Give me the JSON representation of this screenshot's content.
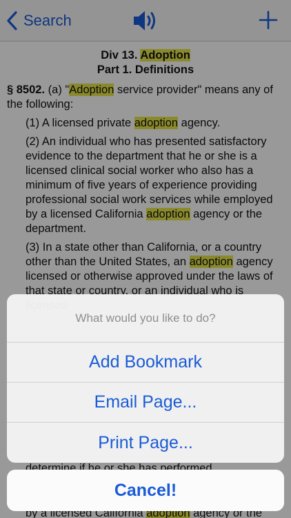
{
  "nav": {
    "back_label": "Search",
    "speaker_icon": "speaker-icon",
    "add_icon": "plus-icon"
  },
  "doc": {
    "div_prefix": "Div 13.",
    "div_highlight": "Adoption",
    "part_title": "Part 1. Definitions",
    "section": {
      "number": "§ 8502.",
      "lead": "(a) \"",
      "lead_hl": "Adoption",
      "lead_rest": " service provider\" means any of the following:"
    },
    "items": [
      {
        "pre": "(1) A licensed private ",
        "hl": "adoption",
        "post": " agency."
      },
      {
        "pre": "(2) An individual who has presented satisfactory evidence to the department that he or she is a licensed clinical social worker who also has a minimum of five years of experience providing professional social work services while employed by a licensed California ",
        "hl": "adoption",
        "post": " agency or the department."
      },
      {
        "pre": "(3) In a state other than California, or a country other than the United States, an ",
        "hl": "adoption",
        "post": " agency licensed or otherwise approved under the laws of that state or country, or an individual who is licensed"
      }
    ],
    "fragment_tail": "determine if he or she has performed",
    "fragment_last_pre": "by a licensed California ",
    "fragment_last_hl": "adoption",
    "fragment_last_post": " agency or the"
  },
  "sheet": {
    "title": "What would you like to do?",
    "buttons": [
      "Add Bookmark",
      "Email Page...",
      "Print Page..."
    ],
    "cancel": "Cancel!"
  },
  "colors": {
    "accent": "#1a5bd6",
    "highlight": "#e6e64a"
  }
}
